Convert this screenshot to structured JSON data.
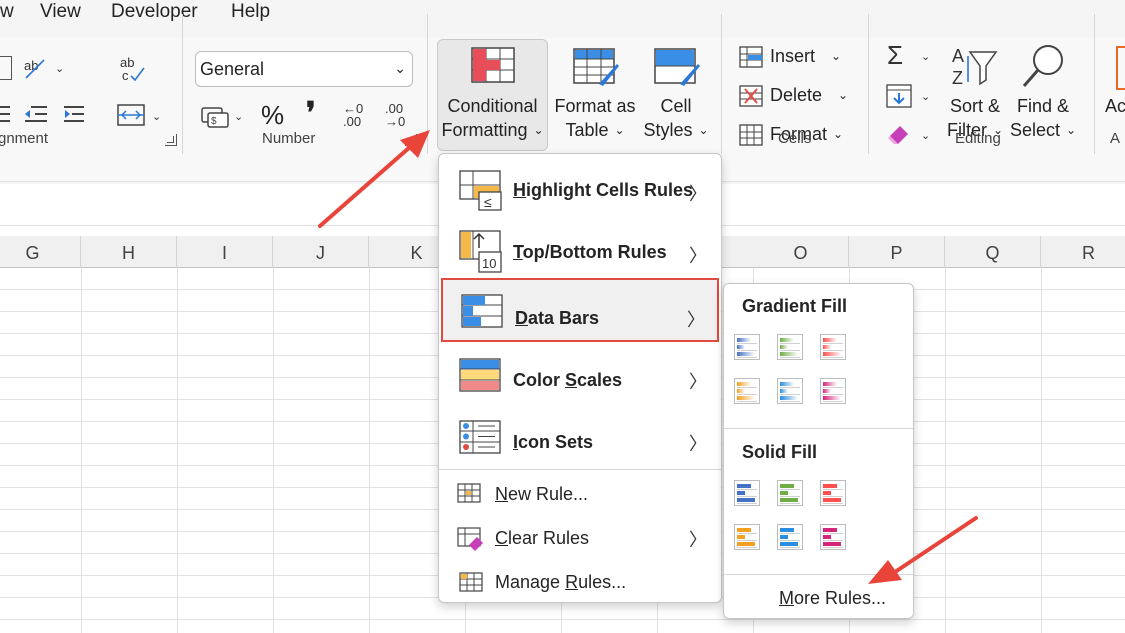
{
  "menubar": {
    "items": [
      "w",
      "View",
      "Developer",
      "Help"
    ]
  },
  "ribbon": {
    "alignment_group_label": "gnment",
    "number": {
      "group_label": "Number",
      "format_value": "General",
      "percent": "%",
      "comma": "❜",
      "inc_top": "←0",
      "inc_bottom": ".00",
      "dec_top": ".00",
      "dec_bottom": "→0"
    },
    "styles": {
      "conditional_line1": "Conditional",
      "conditional_line2": "Formatting",
      "format_as_table_line1": "Format as",
      "format_as_table_line2": "Table",
      "cell_styles_line1": "Cell",
      "cell_styles_line2": "Styles"
    },
    "cells": {
      "group_label": "Cells",
      "insert": "Insert",
      "delete": "Delete",
      "format": "Format"
    },
    "editing": {
      "group_label": "Editing",
      "sort_line1": "Sort &",
      "sort_line2": "Filter",
      "find_line1": "Find &",
      "find_line2": "Select"
    },
    "cut_off_right": "Ac",
    "cut_off_right_label": "A"
  },
  "columns": [
    "G",
    "H",
    "I",
    "J",
    "K",
    "O",
    "P",
    "Q",
    "R"
  ],
  "cf_menu": {
    "highlight": {
      "prefix": "",
      "underline": "H",
      "rest": "ighlight Cells Rules"
    },
    "topbottom": {
      "underline": "T",
      "rest": "op/Bottom Rules"
    },
    "databars": {
      "underline": "D",
      "rest": "ata Bars"
    },
    "colorscales": {
      "pre": "Color ",
      "underline": "S",
      "rest": "cales"
    },
    "iconsets": {
      "underline": "I",
      "rest": "con Sets"
    },
    "newrule": {
      "underline": "N",
      "rest": "ew Rule..."
    },
    "clearrules": {
      "underline": "C",
      "rest": "lear Rules"
    },
    "managerules": {
      "pre": "Manage ",
      "underline": "R",
      "rest": "ules..."
    }
  },
  "databars_submenu": {
    "gradient_heading": "Gradient Fill",
    "solid_heading": "Solid Fill",
    "more_underline": "M",
    "more_rest": "ore Rules...",
    "colors": [
      "#4472c4",
      "#70ad47",
      "#ff5050",
      "#f4a020",
      "#2a8de0",
      "#d6247a"
    ]
  },
  "accent": "#e04a3f"
}
